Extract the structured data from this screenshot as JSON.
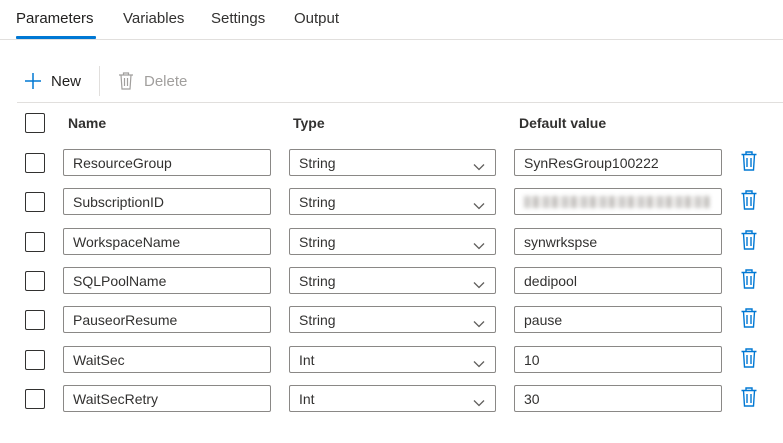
{
  "tabs": [
    {
      "label": "Parameters",
      "active": true
    },
    {
      "label": "Variables"
    },
    {
      "label": "Settings"
    },
    {
      "label": "Output"
    }
  ],
  "toolbar": {
    "new_label": "New",
    "delete_label": "Delete"
  },
  "table": {
    "headers": {
      "name": "Name",
      "type": "Type",
      "default": "Default value"
    },
    "rows": [
      {
        "name": "ResourceGroup",
        "type": "String",
        "default": "SynResGroup100222"
      },
      {
        "name": "SubscriptionID",
        "type": "String",
        "default": "",
        "default_redacted": true
      },
      {
        "name": "WorkspaceName",
        "type": "String",
        "default": "synwrkspse"
      },
      {
        "name": "SQLPoolName",
        "type": "String",
        "default": "dedipool"
      },
      {
        "name": "PauseorResume",
        "type": "String",
        "default": "pause"
      },
      {
        "name": "WaitSec",
        "type": "Int",
        "default": "10"
      },
      {
        "name": "WaitSecRetry",
        "type": "Int",
        "default": "30"
      }
    ]
  },
  "colors": {
    "accent": "#0078d4",
    "text": "#323130",
    "disabled": "#a19f9d"
  }
}
